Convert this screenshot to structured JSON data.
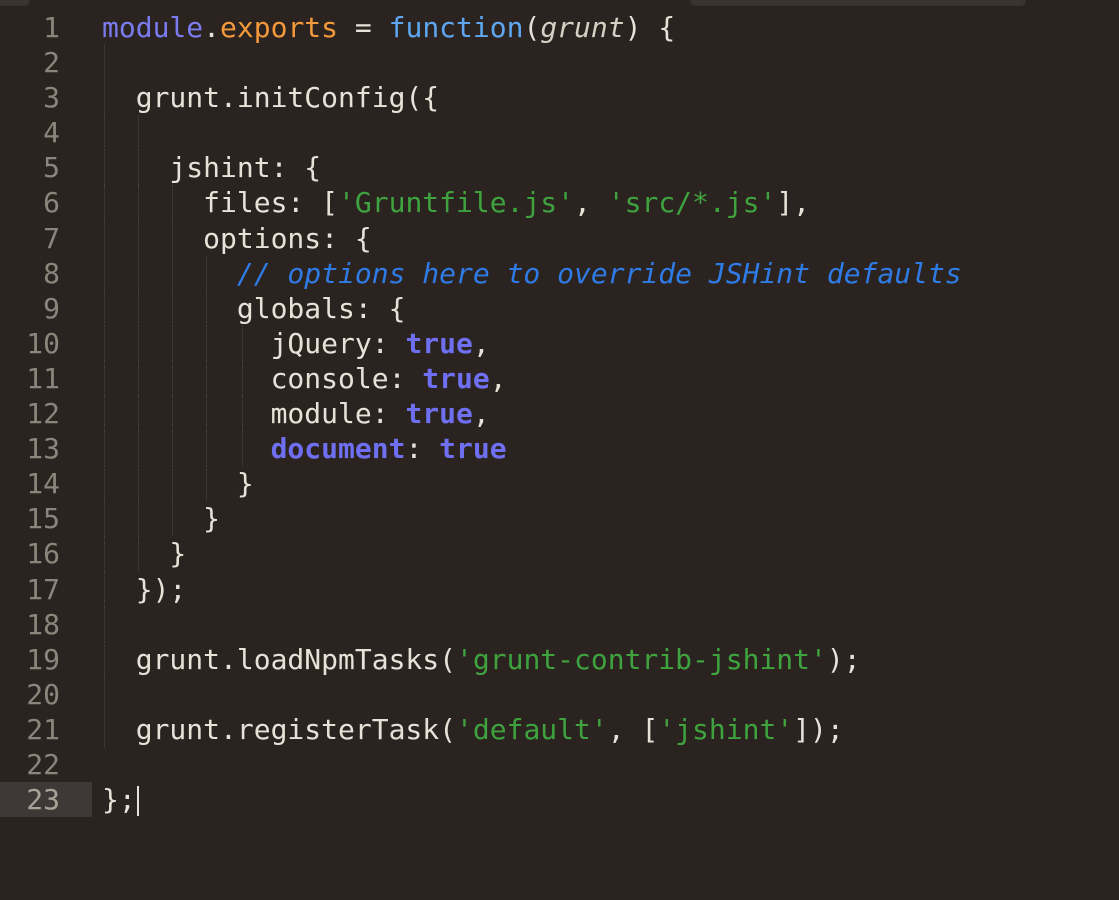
{
  "editor": {
    "line_numbers": [
      "1",
      "2",
      "3",
      "4",
      "5",
      "6",
      "7",
      "8",
      "9",
      "10",
      "11",
      "12",
      "13",
      "14",
      "15",
      "16",
      "17",
      "18",
      "19",
      "20",
      "21",
      "22",
      "23"
    ],
    "active_line": "23",
    "code": {
      "l1": {
        "a": "module",
        "b": ".",
        "c": "exports",
        "d": " = ",
        "e": "function",
        "f": "(",
        "g": "grunt",
        "h": ") {"
      },
      "l3": {
        "a": "  grunt.initConfig({"
      },
      "l5": {
        "a": "    jshint: {"
      },
      "l6": {
        "a": "      files: [",
        "b": "'Gruntfile.js'",
        "c": ", ",
        "d": "'src/*.js'",
        "e": "],"
      },
      "l7": {
        "a": "      options: {"
      },
      "l8": {
        "a": "        ",
        "b": "// options here to override JSHint defaults"
      },
      "l9": {
        "a": "        globals: {"
      },
      "l10": {
        "a": "          jQuery: ",
        "b": "true",
        "c": ","
      },
      "l11": {
        "a": "          console: ",
        "b": "true",
        "c": ","
      },
      "l12": {
        "a": "          module: ",
        "b": "true",
        "c": ","
      },
      "l13": {
        "a": "          ",
        "b": "document",
        "c": ": ",
        "d": "true"
      },
      "l14": {
        "a": "        }"
      },
      "l15": {
        "a": "      }"
      },
      "l16": {
        "a": "    }"
      },
      "l17": {
        "a": "  });"
      },
      "l19": {
        "a": "  grunt.loadNpmTasks(",
        "b": "'grunt-contrib-jshint'",
        "c": ");"
      },
      "l21": {
        "a": "  grunt.registerTask(",
        "b": "'default'",
        "c": ", [",
        "d": "'jshint'",
        "e": "]);"
      },
      "l23": {
        "a": "};"
      }
    }
  },
  "colors": {
    "background": "#2b2320",
    "keyword": "#7b7bf0",
    "property": "#f29a3b",
    "function_keyword": "#5ea6ef",
    "string": "#3ea33e",
    "comment": "#2f7be6",
    "boolean": "#6f6ff2"
  }
}
